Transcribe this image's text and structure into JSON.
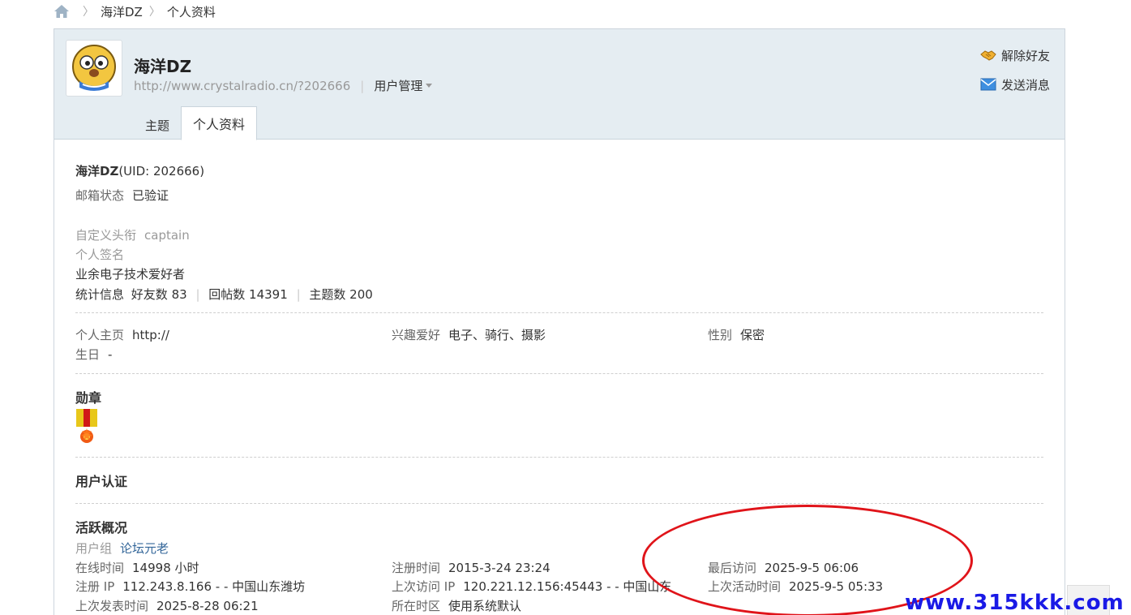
{
  "breadcrumb": {
    "sep": "〉",
    "site": "海洋DZ",
    "page": "个人资料"
  },
  "header": {
    "username": "海洋DZ",
    "url": "http://www.crystalradio.cn/?202666",
    "manage_label": "用户管理",
    "remove_friend": "解除好友",
    "send_message": "发送消息",
    "tabs": [
      "主题",
      "个人资料"
    ]
  },
  "profile": {
    "name": "海洋DZ",
    "uid": "(UID: 202666)",
    "email_label": "邮箱状态",
    "email_value": "已验证",
    "title_label": "自定义头衔",
    "title_value": "captain",
    "sign_label": "个人签名",
    "sign_value": "业余电子技术爱好者",
    "stats_label": "统计信息",
    "friends": "好友数 83",
    "replies": "回帖数 14391",
    "threads": "主题数 200",
    "pipe": "|",
    "homepage_label": "个人主页",
    "homepage_value": "http://",
    "hobby_label": "兴趣爱好",
    "hobby_value": "电子、骑行、摄影",
    "gender_label": "性别",
    "gender_value": "保密",
    "birthday_label": "生日",
    "birthday_value": "-"
  },
  "sections": {
    "medal": "勋章",
    "verify": "用户认证",
    "activity": "活跃概况"
  },
  "activity": {
    "group_label": "用户组",
    "group_value": "论坛元老",
    "online_label": "在线时间",
    "online_value": "14998 小时",
    "reg_time_label": "注册时间",
    "reg_time_value": "2015-3-24 23:24",
    "last_visit_label": "最后访问",
    "last_visit_value": "2025-9-5 06:06",
    "reg_ip_label": "注册 IP",
    "reg_ip_value": "112.243.8.166 - - 中国山东潍坊",
    "last_ip_label": "上次访问 IP",
    "last_ip_value": "120.221.12.156:45443 - - 中国山东",
    "last_active_label": "上次活动时间",
    "last_active_value": "2025-9-5 05:33",
    "last_post_label": "上次发表时间",
    "last_post_value": "2025-8-28 06:21",
    "tz_label": "所在时区",
    "tz_value": "使用系统默认"
  },
  "watermark": "www.315kkk.com"
}
